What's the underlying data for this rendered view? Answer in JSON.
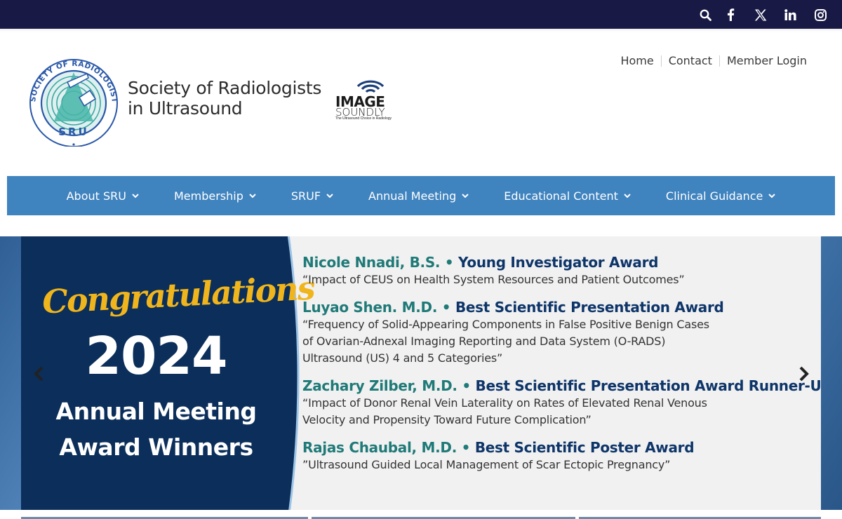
{
  "topbar": {
    "icons": [
      "search-icon",
      "facebook-icon",
      "x-twitter-icon",
      "linkedin-icon",
      "instagram-icon"
    ],
    "bg_color": "#181a45"
  },
  "header": {
    "org_name_line1": "Society of Radiologists",
    "org_name_line2": "in Ultrasound",
    "seal_text": "SOCIETY OF RADIOLOGISTS IN ULTRASOUND",
    "seal_letters": "SRU",
    "sponsor_big": "IMAGE",
    "sponsor_mid": "SOUNDLY",
    "sponsor_tagline": "The Ultrasound Choice in Radiology",
    "utility_links": [
      {
        "label": "Home"
      },
      {
        "label": "Contact"
      },
      {
        "label": "Member Login"
      }
    ]
  },
  "mainnav": {
    "bg_color": "#3f83bf",
    "items": [
      {
        "label": "About SRU"
      },
      {
        "label": "Membership"
      },
      {
        "label": "SRUF"
      },
      {
        "label": "Annual Meeting"
      },
      {
        "label": "Educational Content"
      },
      {
        "label": "Clinical Guidance"
      }
    ]
  },
  "slider": {
    "congrats": "Congratulations",
    "year": "2024",
    "meeting_line1": "Annual Meeting",
    "meeting_line2": "Award Winners",
    "awards": [
      {
        "winner": "Nicole Nnadi, B.S. •",
        "award": "Young Investigator Award",
        "desc_lines": [
          "“Impact of CEUS on Health System Resources and Patient Outcomes”"
        ]
      },
      {
        "winner": "Luyao Shen. M.D. •",
        "award": "Best Scientific Presentation Award",
        "desc_lines": [
          "“Frequency of Solid-Appearing Components in False Positive Benign Cases",
          "of Ovarian-Adnexal Imaging Reporting and Data System (O-RADS)",
          "Ultrasound (US) 4 and 5 Categories”"
        ]
      },
      {
        "winner": "Zachary Zilber, M.D. •",
        "award": "Best Scientific Presentation Award Runner-Up",
        "desc_lines": [
          "“Impact of Donor Renal Vein Laterality on Rates of Elevated Renal Venous",
          "Velocity and Propensity Toward Future Complication”"
        ]
      },
      {
        "winner": "Rajas Chaubal, M.D. •",
        "award": "Best Scientific Poster Award",
        "desc_lines": [
          "”Ultrasound Guided Local Management of Scar Ectopic Pregnancy”"
        ]
      }
    ]
  }
}
